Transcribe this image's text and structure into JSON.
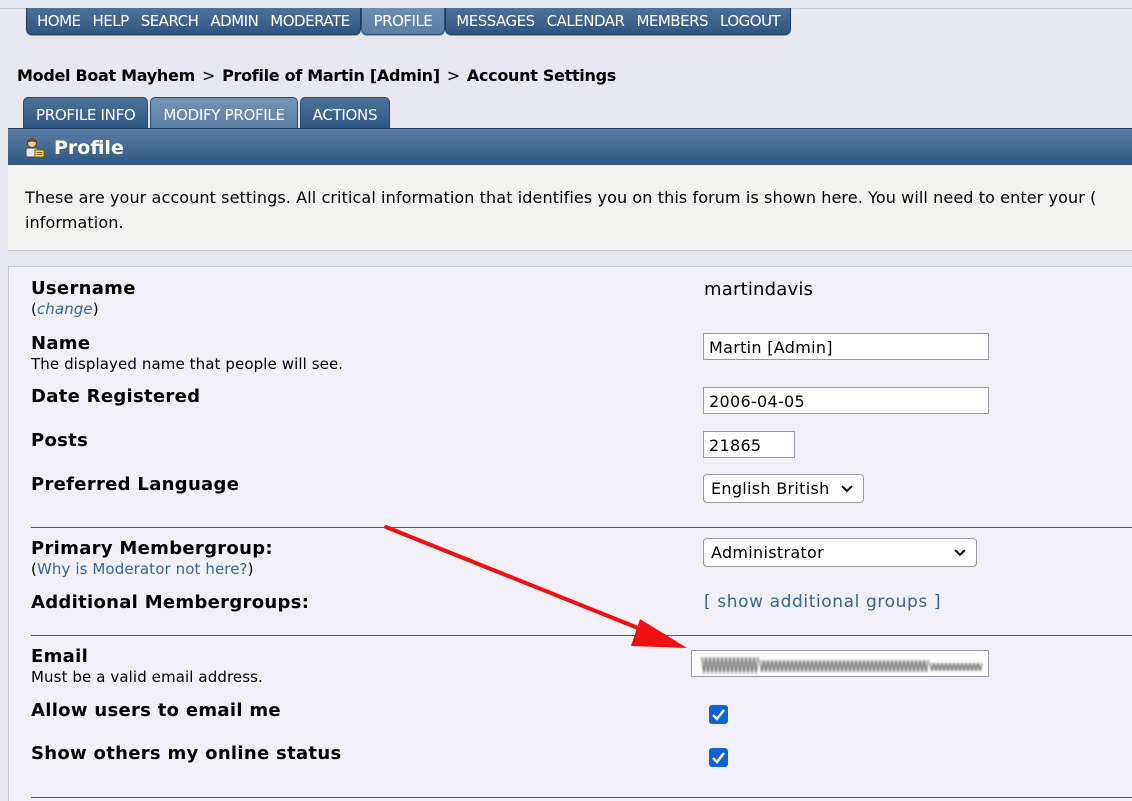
{
  "menu": {
    "items": [
      "HOME",
      "HELP",
      "SEARCH",
      "ADMIN",
      "MODERATE",
      "PROFILE",
      "MESSAGES",
      "CALENDAR",
      "MEMBERS",
      "LOGOUT"
    ],
    "active": "PROFILE"
  },
  "breadcrumb": {
    "forum": "Model Boat Mayhem",
    "profile": "Profile of Martin [Admin]",
    "page": "Account Settings",
    "separator": ">"
  },
  "tabs": {
    "profile_info": "PROFILE INFO",
    "modify_profile": "MODIFY PROFILE",
    "actions": "ACTIONS"
  },
  "header": {
    "title": "Profile",
    "icon": "profile-user-icon",
    "intro": "These are your account settings. All critical information that identifies you on this forum is shown here. You will need to enter your (",
    "intro_2": "information."
  },
  "form": {
    "username_label": "Username",
    "username_paren_open": "(",
    "username_change": "change",
    "username_paren_close": ")",
    "username_value": "martindavis",
    "name_label": "Name",
    "name_desc": "The displayed name that people will see.",
    "name_value": "Martin [Admin]",
    "date_label": "Date Registered",
    "date_value": "2006-04-05",
    "posts_label": "Posts",
    "posts_value": "21865",
    "language_label": "Preferred Language",
    "language_value": "English British",
    "primary_group_label": "Primary Membergroup:",
    "primary_group_help": "Why is Moderator not here?",
    "primary_group_value": "Administrator",
    "additional_groups_label": "Additional Membergroups:",
    "additional_groups_link": "[ show additional groups ]",
    "email_label": "Email",
    "email_desc": "Must be a valid email address.",
    "allow_email_label": "Allow users to email me",
    "allow_email_checked": true,
    "online_status_label": "Show others my online status",
    "online_status_checked": true
  },
  "colors": {
    "menu_blue": "#2e5581",
    "link": "#3a6591",
    "checkbox": "#0f62d4",
    "annotation_arrow": "#ee1111"
  }
}
